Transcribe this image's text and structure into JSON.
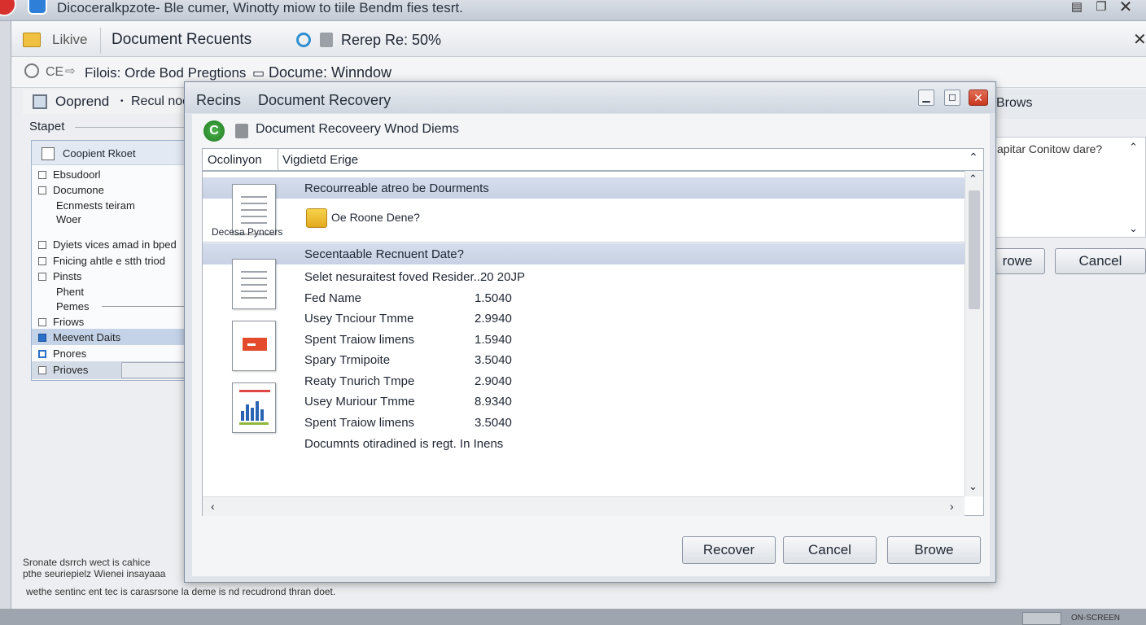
{
  "window": {
    "title": "Dicoceralkpzote- Ble cumer, Winotty miow to tiile Bendm fies tesrt.",
    "tab_label": "Likive",
    "tab_title": "Document Recuents",
    "tab_extra": "Rerep Re: 50%",
    "path": "Filois: Orde Bod Pregtions",
    "path_extra": "Docume: Winndow",
    "path_prefix": "CE",
    "sub_label": "Ooprend",
    "sub_label2": "Recul noc",
    "right_tab": "Brows",
    "right_field": "apitar Conitow dare?",
    "right_btn1": "rowe",
    "right_btn2": "Cancel",
    "section_label": "Stapet"
  },
  "left_panel": {
    "header": "Coopient Rkoet",
    "items": [
      "Ebsudoorl",
      "Documone",
      "Ecnmests teiram",
      "Woer",
      "Dyiets vices amad in bped",
      "Fnicing ahtle e stth triod",
      "Pinsts",
      "Phent",
      "Pemes",
      "Friows",
      "Meevent Daits",
      "Pnores",
      "Prioves"
    ]
  },
  "status_text": [
    "Sronate dsrrch wect is cahice",
    "pthe seuriepielz Wienei insayaaa",
    "wethe sentinc ent tec is carasrsone la deme is nd recudrond thran doet."
  ],
  "dialog": {
    "title_left": "Recins",
    "title": "Document Recovery",
    "header": "Document Recoveery Wnod Diems",
    "field_label": "Ocolinyon",
    "field_value": "Vigdietd Erige",
    "section1": "Recourreable atreo be Dourments",
    "item1_label": "Decesa Pyncers",
    "item1_sub": "Oe Roone Dene?",
    "section2": "Secentaable Recnuent Date?",
    "rows": [
      {
        "name": "Selet nesuraitest foved Resider..20 20JP",
        "value": ""
      },
      {
        "name": "Fed Name",
        "value": "1.5040"
      },
      {
        "name": "Usey Tnciour Tmme",
        "value": "2.9940"
      },
      {
        "name": "Spent Traiow limens",
        "value": "1.5940"
      },
      {
        "name": "Spary Trmipoite",
        "value": "3.5040"
      },
      {
        "name": "Reaty Tnurich Tmpe",
        "value": "2.9040"
      },
      {
        "name": "Usey Muriour Tmme",
        "value": "8.9340"
      },
      {
        "name": "Spent Traiow limens",
        "value": "3.5040"
      },
      {
        "name": "Documnts otiradined is regt. In Inens",
        "value": ""
      }
    ],
    "buttons": {
      "recover": "Recover",
      "cancel": "Cancel",
      "browse": "Browe"
    }
  },
  "taskbar_label": "ON-SCREEN"
}
